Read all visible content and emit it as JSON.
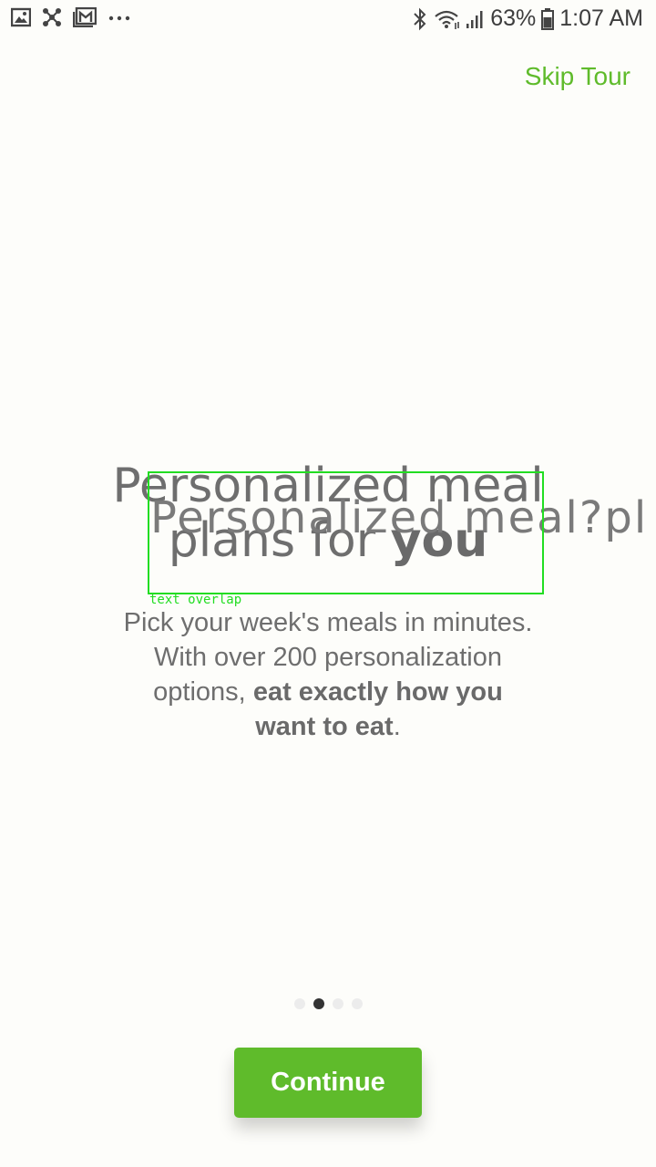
{
  "status_bar": {
    "battery": "63%",
    "time": "1:07 AM",
    "left_icons": [
      "gallery-icon",
      "network-icon",
      "gmail-icon",
      "more-icon"
    ],
    "right_icons": [
      "bluetooth-icon",
      "wifi-icon",
      "signal-icon",
      "battery-icon"
    ]
  },
  "header": {
    "skip_label": "Skip Tour"
  },
  "slide": {
    "headline_line1": "Personalized meal",
    "headline_line2_plain": "plans for ",
    "headline_line2_bold": "you",
    "ghost_headline": "Personalized meal?pl",
    "body_line1": "Pick your week's meals in minutes.",
    "body_line2": "With over 200 personalization",
    "body_line3_plain": "options, ",
    "body_line3_bold": "eat exactly how you",
    "body_line4_bold": "want to eat",
    "body_line4_plain": "."
  },
  "overlay": {
    "label": "text overlap"
  },
  "pager": {
    "total": 4,
    "active_index": 1
  },
  "footer": {
    "continue_label": "Continue"
  },
  "colors": {
    "accent": "#5fbb2b",
    "background": "#fdfdfa",
    "text": "#6e6e6e",
    "overlay": "#22dd22"
  }
}
